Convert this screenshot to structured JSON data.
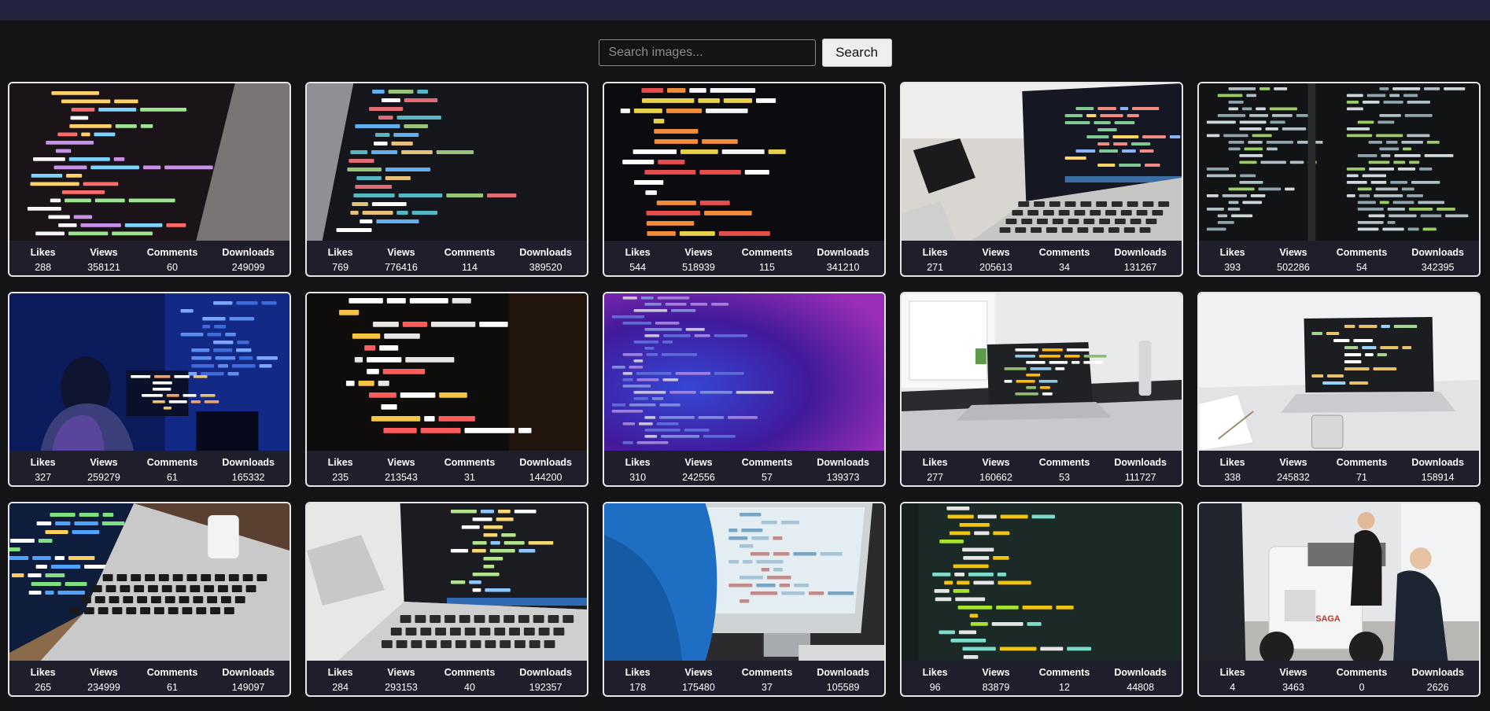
{
  "search": {
    "placeholder": "Search images...",
    "button_label": "Search"
  },
  "stat_labels": {
    "likes": "Likes",
    "views": "Views",
    "comments": "Comments",
    "downloads": "Downloads"
  },
  "cards": [
    {
      "theme": "code-laptop-dark-angle",
      "likes": "288",
      "views": "358121",
      "comments": "60",
      "downloads": "249099"
    },
    {
      "theme": "code-screen-colorful",
      "likes": "769",
      "views": "776416",
      "comments": "114",
      "downloads": "389520"
    },
    {
      "theme": "html-code-closeup",
      "likes": "544",
      "views": "518939",
      "comments": "115",
      "downloads": "341210"
    },
    {
      "theme": "laptop-desk-phone",
      "likes": "271",
      "views": "205613",
      "comments": "34",
      "downloads": "131267"
    },
    {
      "theme": "code-dark-columns",
      "likes": "393",
      "views": "502286",
      "comments": "54",
      "downloads": "342395"
    },
    {
      "theme": "developer-blue-room",
      "likes": "327",
      "views": "259279",
      "comments": "61",
      "downloads": "165332"
    },
    {
      "theme": "jquery-code-closeup",
      "likes": "235",
      "views": "213543",
      "comments": "31",
      "downloads": "144200"
    },
    {
      "theme": "code-purple-blur",
      "likes": "310",
      "views": "242556",
      "comments": "57",
      "downloads": "139373"
    },
    {
      "theme": "laptop-white-office",
      "likes": "277",
      "views": "160662",
      "comments": "53",
      "downloads": "111727"
    },
    {
      "theme": "laptop-white-desk-notebook",
      "likes": "338",
      "views": "245832",
      "comments": "71",
      "downloads": "158914"
    },
    {
      "theme": "laptop-keyboard-angle",
      "likes": "265",
      "views": "234999",
      "comments": "61",
      "downloads": "149097"
    },
    {
      "theme": "laptop-code-blurred",
      "likes": "284",
      "views": "293153",
      "comments": "40",
      "downloads": "192357"
    },
    {
      "theme": "imac-typing",
      "likes": "178",
      "views": "175480",
      "comments": "37",
      "downloads": "105589"
    },
    {
      "theme": "code-green-editor",
      "likes": "96",
      "views": "83879",
      "comments": "12",
      "downloads": "44808"
    },
    {
      "theme": "robotics-team",
      "likes": "4",
      "views": "3463",
      "comments": "0",
      "downloads": "2626"
    }
  ]
}
